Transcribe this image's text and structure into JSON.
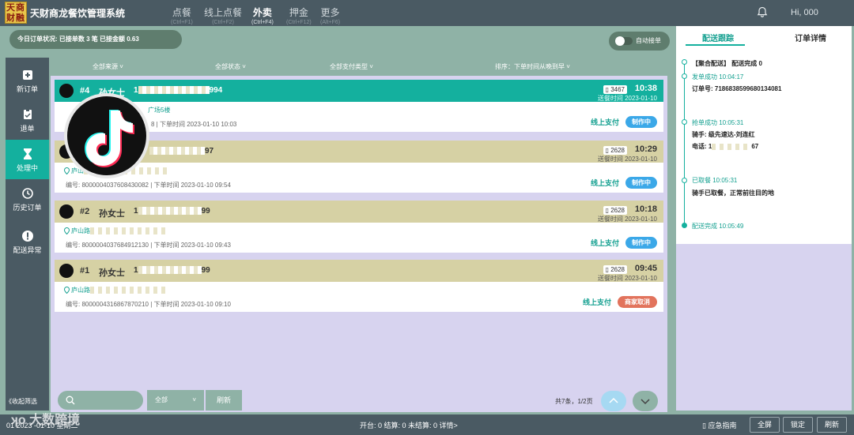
{
  "app": {
    "logo_text": "天商财融",
    "title": "天财商龙餐饮管理系统",
    "user": "Hi, 000"
  },
  "nav": [
    {
      "label": "点餐",
      "hint": "(Ctrl+F1)"
    },
    {
      "label": "线上点餐",
      "hint": "(Ctrl+F2)"
    },
    {
      "label": "外卖",
      "hint": "(Ctrl+F4)"
    },
    {
      "label": "押金",
      "hint": "(Ctrl+F12)"
    },
    {
      "label": "更多",
      "hint": "(Alt+F6)"
    }
  ],
  "status": {
    "text": "今日订单状况:  已接单数  3  笔      已接金额  0.63"
  },
  "auto_accept": "自动接单",
  "sidebar": [
    "新订单",
    "退单",
    "处理中",
    "历史订单",
    "配送异常"
  ],
  "collapse": "《收起筛选",
  "filters": [
    "全部来源",
    "全部状态",
    "全部支付类型",
    "排序：下单时间从晚到早"
  ],
  "orders": [
    {
      "num": "#4",
      "name": "孙女士",
      "phone_start": "1",
      "phone_end": "994",
      "code": "3467",
      "time": "10:38",
      "date": "送餐时间 2023-01-10",
      "addr": "广场5楼",
      "meta": "编号: 800000...8  |  下单时间 2023-01-10 10:03",
      "pay": "线上支付",
      "state": "制作中"
    },
    {
      "num": "#3",
      "name": "",
      "phone_start": "",
      "phone_end": "97",
      "code": "2628",
      "time": "10:29",
      "date": "送餐时间 2023-01-10",
      "addr": "庐山",
      "meta": "编号: 8000004037608430082  |  下单时间 2023-01-10 09:54",
      "pay": "线上支付",
      "state": "制作中"
    },
    {
      "num": "#2",
      "name": "孙女士",
      "phone_start": "1",
      "phone_end": "99",
      "code": "2628",
      "time": "10:18",
      "date": "送餐时间 2023-01-10",
      "addr": "庐山路",
      "meta": "编号: 8000004037684912130  |  下单时间 2023-01-10 09:43",
      "pay": "线上支付",
      "state": "制作中"
    },
    {
      "num": "#1",
      "name": "孙女士",
      "phone_start": "1",
      "phone_end": "99",
      "code": "2628",
      "time": "09:45",
      "date": "送餐时间 2023-01-10",
      "addr": "庐山路",
      "meta": "编号: 8000004316867870210  |  下单时间 2023-01-10 09:10",
      "pay": "线上支付",
      "state": "商家取消"
    }
  ],
  "list_controls": {
    "select": "全部",
    "refresh": "刷新",
    "page_info": "共7条，1/2页"
  },
  "right_panel": {
    "tabs": [
      "配送跟踪",
      "订单详情"
    ],
    "title": "【聚合配送】 配送完成 0",
    "events": [
      {
        "label": "发单成功",
        "time": "10:04:17",
        "line2": "订单号: 7186838599680134081"
      },
      {
        "label": "抢单成功",
        "time": "10:05:31",
        "line2": "骑手: 级先速达-刘连红",
        "line3_start": "电话: 1",
        "line3_end": "67"
      },
      {
        "label": "已取餐",
        "time": "10:05:31",
        "line2": "骑手已取餐，正常前往目的地"
      },
      {
        "label": "配送完成",
        "time": "10:05:49"
      }
    ]
  },
  "footer": {
    "left": "01 2023 -01-10 星期二",
    "counts": "开台: 0    结算: 0    未结算: 0    详情>",
    "help": "应急指南",
    "buttons": [
      "全屏",
      "锁定",
      "刷新"
    ]
  },
  "watermark": "大数跨境"
}
